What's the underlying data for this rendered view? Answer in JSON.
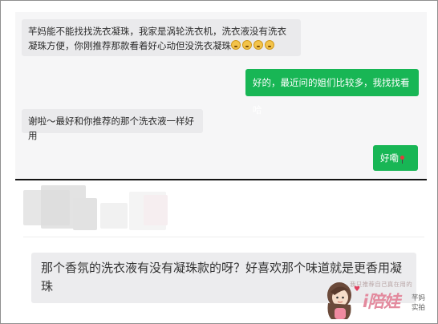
{
  "chat": {
    "messages": [
      {
        "side": "in",
        "text": "芊妈能不能找找洗衣凝珠，我家是涡轮洗衣机，洗衣液没有洗衣凝珠方便，你刚推荐那款看着好心动但没洗衣凝珠",
        "emoji_count": 4
      },
      {
        "side": "out",
        "text": "好的，最近问的姐们比较多，我找找看哈"
      },
      {
        "side": "in",
        "text": "谢啦～最好和你推荐的那个洗衣液一样好用"
      },
      {
        "side": "out",
        "text": "好嘞"
      }
    ]
  },
  "question": {
    "text": "那个香氛的洗衣液有没有凝珠款的呀？好喜欢那个味道就是更香用凝珠"
  },
  "watermark": {
    "tagline": "我只推荐自己真在用的",
    "brand": "i陪娃",
    "side_line1": "芊妈",
    "side_line2": "实拍"
  },
  "colors": {
    "accent_green": "#18b655",
    "incoming_bubble": "#eaeaec",
    "question_bubble": "#ececee",
    "watermark_pink": "#e38a9e"
  }
}
